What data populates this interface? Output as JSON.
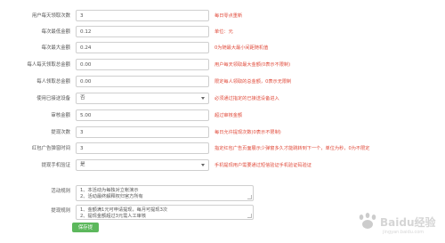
{
  "form": {
    "rows": [
      {
        "label": "用户每天领取次数",
        "value": "3",
        "hint": "每日零点重新"
      },
      {
        "label": "每次最低金额",
        "value": "0.12",
        "hint": "单位：元"
      },
      {
        "label": "每次最大金额",
        "value": "0.24",
        "hint": "0为随最大最小间距随机值"
      },
      {
        "label": "每人每天领取总金额",
        "value": "0.00",
        "hint": "用户每天领取最大金额(0表示不限制)"
      },
      {
        "label": "每人领取总金额",
        "value": "0.00",
        "hint": "限定每人领取的总金额，0表示无限制"
      },
      {
        "label": "使用已接送设备",
        "select": "否",
        "hint": "必须通过指定的已接送设备进入"
      },
      {
        "label": "审核金额",
        "value": "5.00",
        "hint": "超过审核金额"
      },
      {
        "label": "提现次数",
        "value": "3",
        "hint": "每日允许提现次数(0表示不限制)"
      },
      {
        "label": "红包广告弹窗时间",
        "value": "3",
        "hint": "指定红包广告页面展示少弹窗多久才能跳转到下一个，单位为秒，0为不限定"
      },
      {
        "label": "提现手机验证",
        "select": "是",
        "hint": "手机提现用户需要通过短信验证手机验证码验证"
      }
    ],
    "rules_label": "活动规则",
    "rules_lines": [
      "1、本活动为每独对立帐演示",
      "2、活动最终解释权归官方所有"
    ],
    "withdraw_rules_label": "提现规则",
    "withdraw_rules_lines": [
      "1、金额满1元可申请提现，每月可提现3次",
      "2、提现金额超过3元需人工审核"
    ],
    "save_label": "保存提交"
  },
  "watermark": {
    "text": "Baidu经验",
    "sub": "jingyan.baidu.com"
  }
}
